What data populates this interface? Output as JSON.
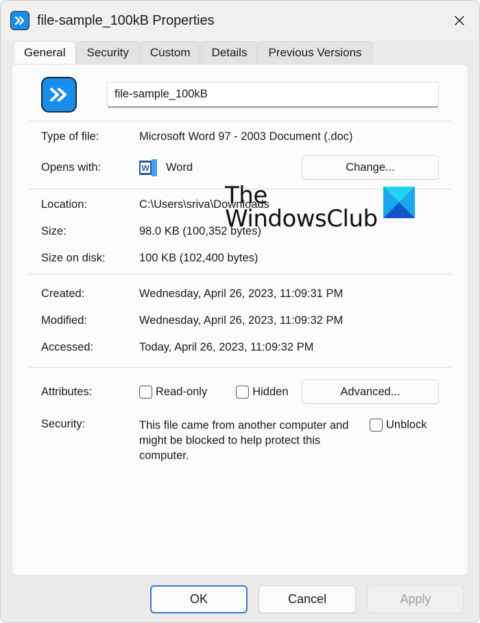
{
  "window": {
    "title": "file-sample_100kB Properties",
    "icon": "double-chevron-icon",
    "close_label": "✕"
  },
  "tabs": [
    {
      "label": "General",
      "active": true
    },
    {
      "label": "Security",
      "active": false
    },
    {
      "label": "Custom",
      "active": false
    },
    {
      "label": "Details",
      "active": false
    },
    {
      "label": "Previous Versions",
      "active": false
    }
  ],
  "file": {
    "icon": "double-chevron-icon",
    "name_value": "file-sample_100kB",
    "name_placeholder": "File name"
  },
  "general": {
    "type_of_file_label": "Type of file:",
    "type_of_file_value": "Microsoft Word 97 - 2003 Document (.doc)",
    "opens_with_label": "Opens with:",
    "opens_with_app": "Word",
    "opens_with_icon": "word-icon",
    "change_button": "Change...",
    "location_label": "Location:",
    "location_value": "C:\\Users\\sriva\\Downloads",
    "size_label": "Size:",
    "size_value": "98.0 KB (100,352 bytes)",
    "size_on_disk_label": "Size on disk:",
    "size_on_disk_value": "100 KB (102,400 bytes)",
    "created_label": "Created:",
    "created_value": "Wednesday, April 26, 2023, 11:09:31 PM",
    "modified_label": "Modified:",
    "modified_value": "Wednesday, April 26, 2023, 11:09:32 PM",
    "accessed_label": "Accessed:",
    "accessed_value": "Today, April 26, 2023, 11:09:32 PM",
    "attributes_label": "Attributes:",
    "readonly_label": "Read-only",
    "readonly_checked": false,
    "hidden_label": "Hidden",
    "hidden_checked": false,
    "advanced_button": "Advanced...",
    "security_label": "Security:",
    "security_text": "This file came from another computer and might be blocked to help protect this computer.",
    "unblock_label": "Unblock",
    "unblock_checked": false
  },
  "footer": {
    "ok_label": "OK",
    "cancel_label": "Cancel",
    "apply_label": "Apply",
    "apply_disabled": true
  },
  "watermark": {
    "line1": "The",
    "line2": "WindowsClub",
    "logo": "thewindowsclub-logo"
  },
  "colors": {
    "accent_blue": "#1a8ceb",
    "focus_blue": "#2e7cd6",
    "word_blue": "#2b5797",
    "logo_cyan": "#22d3ee",
    "logo_blue": "#1a6fe0",
    "panel_bg": "#fbfbfb",
    "dialog_bg": "#eceaea"
  }
}
